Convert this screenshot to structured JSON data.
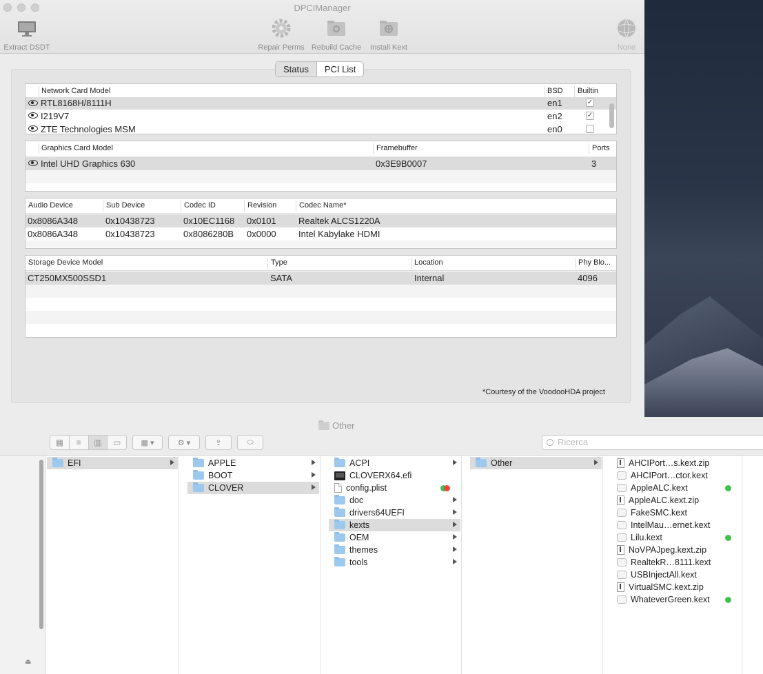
{
  "app": {
    "title": "DPCIManager",
    "toolbar": {
      "extract": "Extract DSDT",
      "repair": "Repair Perms",
      "rebuild": "Rebuild Cache",
      "install": "Install Kext",
      "none": "None"
    },
    "tabs": [
      "Status",
      "PCI List"
    ],
    "network": {
      "headers": [
        "Network Card Model",
        "BSD",
        "Builtin"
      ],
      "rows": [
        {
          "model": "RTL8168H/8111H",
          "bsd": "en1",
          "builtin": true
        },
        {
          "model": "I219V7",
          "bsd": "en2",
          "builtin": true
        },
        {
          "model": "ZTE Technologies MSM",
          "bsd": "en0",
          "builtin": false
        }
      ]
    },
    "graphics": {
      "headers": [
        "Graphics Card Model",
        "Framebuffer",
        "Ports"
      ],
      "rows": [
        {
          "model": "Intel UHD Graphics 630",
          "framebuffer": "0x3E9B0007",
          "ports": "3"
        }
      ]
    },
    "audio": {
      "headers": [
        "Audio Device",
        "Sub Device",
        "Codec ID",
        "Revision",
        "Codec Name*"
      ],
      "rows": [
        {
          "device": "0x8086A348",
          "sub": "0x10438723",
          "codec": "0x10EC1168",
          "rev": "0x0101",
          "name": "Realtek ALCS1220A"
        },
        {
          "device": "0x8086A348",
          "sub": "0x10438723",
          "codec": "0x8086280B",
          "rev": "0x0000",
          "name": "Intel Kabylake HDMI"
        }
      ]
    },
    "storage": {
      "headers": [
        "Storage Device Model",
        "Type",
        "Location",
        "Phy Blo..."
      ],
      "rows": [
        {
          "model": "CT250MX500SSD1",
          "type": "SATA",
          "location": "Internal",
          "block": "4096"
        }
      ]
    },
    "courtesy": "*Courtesy of the VoodooHDA project"
  },
  "finder": {
    "title": "Other",
    "search_placeholder": "Ricerca",
    "columns": [
      [
        {
          "name": "EFI",
          "icon": "folder-icon",
          "sel": true,
          "arrow": true
        }
      ],
      [
        {
          "name": "APPLE",
          "icon": "folder-icon",
          "arrow": true
        },
        {
          "name": "BOOT",
          "icon": "folder-icon",
          "arrow": true
        },
        {
          "name": "CLOVER",
          "icon": "folder-icon",
          "sel": true,
          "arrow": true
        }
      ],
      [
        {
          "name": "ACPI",
          "icon": "folder-icon",
          "arrow": true
        },
        {
          "name": "CLOVERX64.efi",
          "icon": "efi-icon"
        },
        {
          "name": "config.plist",
          "icon": "document-icon",
          "tags": [
            "green",
            "red"
          ]
        },
        {
          "name": "doc",
          "icon": "folder-icon",
          "arrow": true
        },
        {
          "name": "drivers64UEFI",
          "icon": "folder-icon",
          "arrow": true
        },
        {
          "name": "kexts",
          "icon": "folder-icon",
          "sel": true,
          "arrow": true
        },
        {
          "name": "OEM",
          "icon": "folder-icon",
          "arrow": true
        },
        {
          "name": "themes",
          "icon": "folder-icon",
          "arrow": true
        },
        {
          "name": "tools",
          "icon": "folder-icon",
          "arrow": true
        }
      ],
      [
        {
          "name": "Other",
          "icon": "folder-icon",
          "sel": true,
          "arrow": true
        }
      ],
      [
        {
          "name": "AHCIPort…s.kext.zip",
          "icon": "zip-icon"
        },
        {
          "name": "AHCIPort…ctor.kext",
          "icon": "kext-icon"
        },
        {
          "name": "AppleALC.kext",
          "icon": "kext-icon",
          "tags": [
            "green"
          ]
        },
        {
          "name": "AppleALC.kext.zip",
          "icon": "zip-icon"
        },
        {
          "name": "FakeSMC.kext",
          "icon": "kext-icon"
        },
        {
          "name": "IntelMau…ernet.kext",
          "icon": "kext-icon"
        },
        {
          "name": "Lilu.kext",
          "icon": "kext-icon",
          "tags": [
            "green"
          ]
        },
        {
          "name": "NoVPAJpeg.kext.zip",
          "icon": "zip-icon"
        },
        {
          "name": "RealtekR…8111.kext",
          "icon": "kext-icon"
        },
        {
          "name": "USBInjectAll.kext",
          "icon": "kext-icon"
        },
        {
          "name": "VirtualSMC.kext.zip",
          "icon": "zip-icon"
        },
        {
          "name": "WhateverGreen.kext",
          "icon": "kext-icon",
          "tags": [
            "green"
          ]
        }
      ]
    ]
  }
}
